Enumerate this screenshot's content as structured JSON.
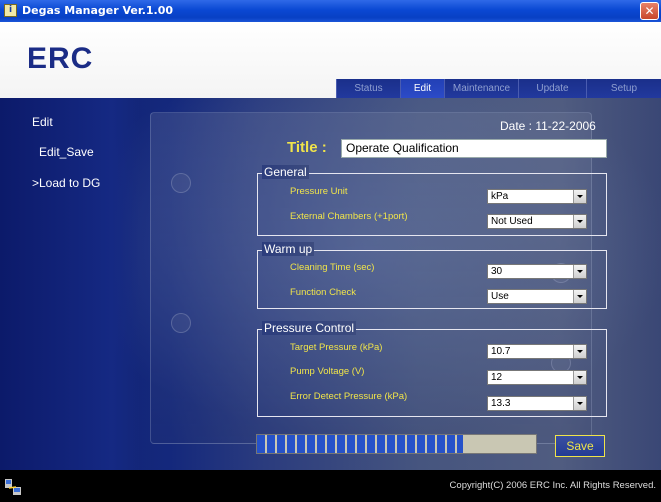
{
  "window": {
    "title": "Degas Manager Ver.1.00",
    "close_glyph": "✕"
  },
  "brand": {
    "logo_text": "ERC"
  },
  "tabs": [
    {
      "label": "Status",
      "active": false
    },
    {
      "label": "Edit",
      "active": true
    },
    {
      "label": "Maintenance",
      "active": false
    },
    {
      "label": "Update",
      "active": false
    },
    {
      "label": "Setup",
      "active": false
    }
  ],
  "sidebar": {
    "heading": "Edit",
    "items": [
      {
        "label": "Edit_Save"
      },
      {
        "label": ">Load to DG"
      }
    ]
  },
  "form": {
    "date_text": "Date : 11-22-2006",
    "title_label": "Title :",
    "title_value": "Operate Qualification",
    "groups": {
      "general": {
        "legend": "General",
        "pressure_unit_label": "Pressure Unit",
        "pressure_unit_value": "kPa",
        "external_chambers_label": "External Chambers (+1port)",
        "external_chambers_value": "Not Used"
      },
      "warmup": {
        "legend": "Warm up",
        "cleaning_time_label": "Cleaning Time (sec)",
        "cleaning_time_value": "30",
        "function_check_label": "Function Check",
        "function_check_value": "Use"
      },
      "pressure_control": {
        "legend": "Pressure Control",
        "target_pressure_label": "Target Pressure (kPa)",
        "target_pressure_value": "10.7",
        "pump_voltage_label": "Pump Voltage (V)",
        "pump_voltage_value": "12",
        "error_detect_label": "Error Detect Pressure (kPa)",
        "error_detect_value": "13.3"
      }
    },
    "progress_fraction": 0.74,
    "save_label": "Save"
  },
  "footer": {
    "link_label": "Link",
    "copyright": "Copyright(C) 2006 ERC Inc. All Rights Reserved."
  },
  "colors": {
    "accent_yellow": "#f0e44a",
    "nav_blue": "#1a2f8a",
    "progress_blue": "#2652c9"
  }
}
